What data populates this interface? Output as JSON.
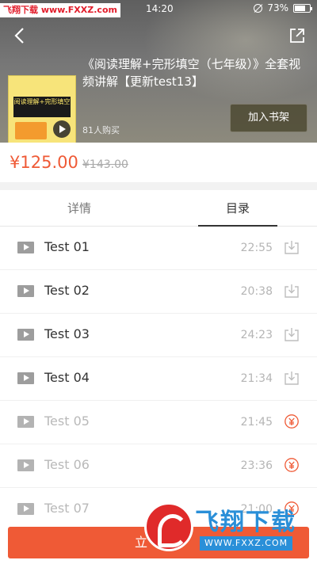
{
  "status_bar": {
    "watermark": "飞翔下载 www.FXXZ.com",
    "time": "14:20",
    "battery": "73%",
    "battery_level": 0.73
  },
  "header": {
    "course_title": "《阅读理解+完形填空（七年级）》全套视频讲解【更新test13】",
    "buyers": "81人购买",
    "shelf_button": "加入书架",
    "cover_text": "阅读理解+完形填空"
  },
  "price": {
    "current": "¥125.00",
    "original": "¥143.00"
  },
  "tabs": [
    {
      "label": "详情",
      "active": false
    },
    {
      "label": "目录",
      "active": true
    }
  ],
  "catalog": [
    {
      "title": "Test 01",
      "duration": "22:55",
      "action_icon": "download-icon"
    },
    {
      "title": "Test 02",
      "duration": "20:38",
      "action_icon": "download-icon"
    },
    {
      "title": "Test 03",
      "duration": "24:23",
      "action_icon": "download-icon"
    },
    {
      "title": "Test 04",
      "duration": "21:34",
      "action_icon": "download-icon"
    },
    {
      "title": "Test 05",
      "duration": "21:45",
      "action_icon": "yuan-purchase-icon"
    },
    {
      "title": "Test 06",
      "duration": "23:36",
      "action_icon": "yuan-purchase-icon"
    },
    {
      "title": "Test 07",
      "duration": "21:00",
      "action_icon": "yuan-purchase-icon"
    }
  ],
  "bottom_bar": {
    "buy_label": "立"
  },
  "watermark_logo": {
    "text": "飞翔下载",
    "url": "WWW.FXXZ.COM"
  },
  "colors": {
    "accent": "#ef5a36",
    "muted": "#b5b5b5"
  }
}
